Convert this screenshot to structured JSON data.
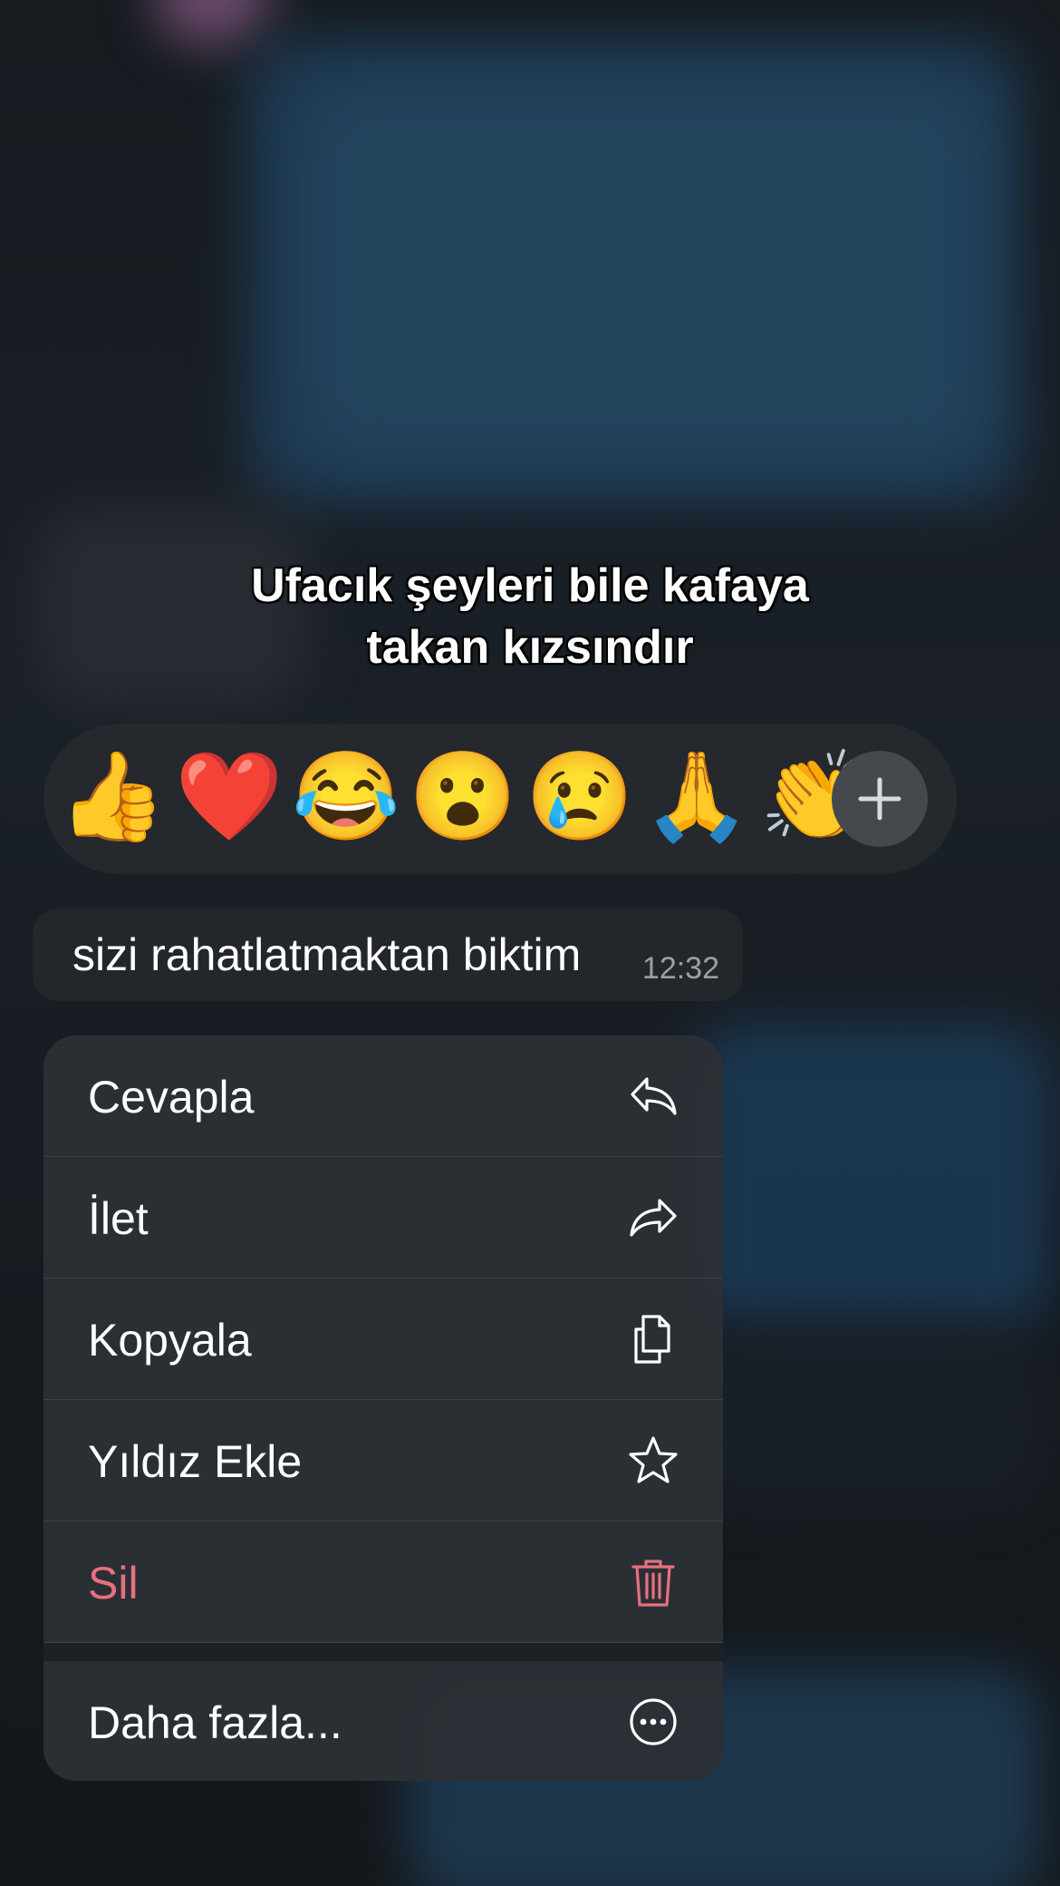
{
  "caption": {
    "line1": "Ufacık şeyleri bile kafaya",
    "line2": "takan kızsındır"
  },
  "reactions": {
    "emojis": [
      "👍",
      "❤️",
      "😂",
      "😮",
      "😢",
      "🙏",
      "👏"
    ],
    "add_icon": "plus-icon"
  },
  "message": {
    "text": "sizi rahatlatmaktan biktim",
    "time": "12:32"
  },
  "menu": {
    "reply": {
      "label": "Cevapla",
      "icon": "reply-icon"
    },
    "forward": {
      "label": "İlet",
      "icon": "forward-icon"
    },
    "copy": {
      "label": "Kopyala",
      "icon": "copy-icon"
    },
    "star": {
      "label": "Yıldız Ekle",
      "icon": "star-icon"
    },
    "delete": {
      "label": "Sil",
      "icon": "trash-icon"
    },
    "more": {
      "label": "Daha fazla...",
      "icon": "more-icon"
    }
  },
  "colors": {
    "destructive": "#e8707e",
    "text": "#ffffff",
    "menu_bg": "#2c3035"
  }
}
